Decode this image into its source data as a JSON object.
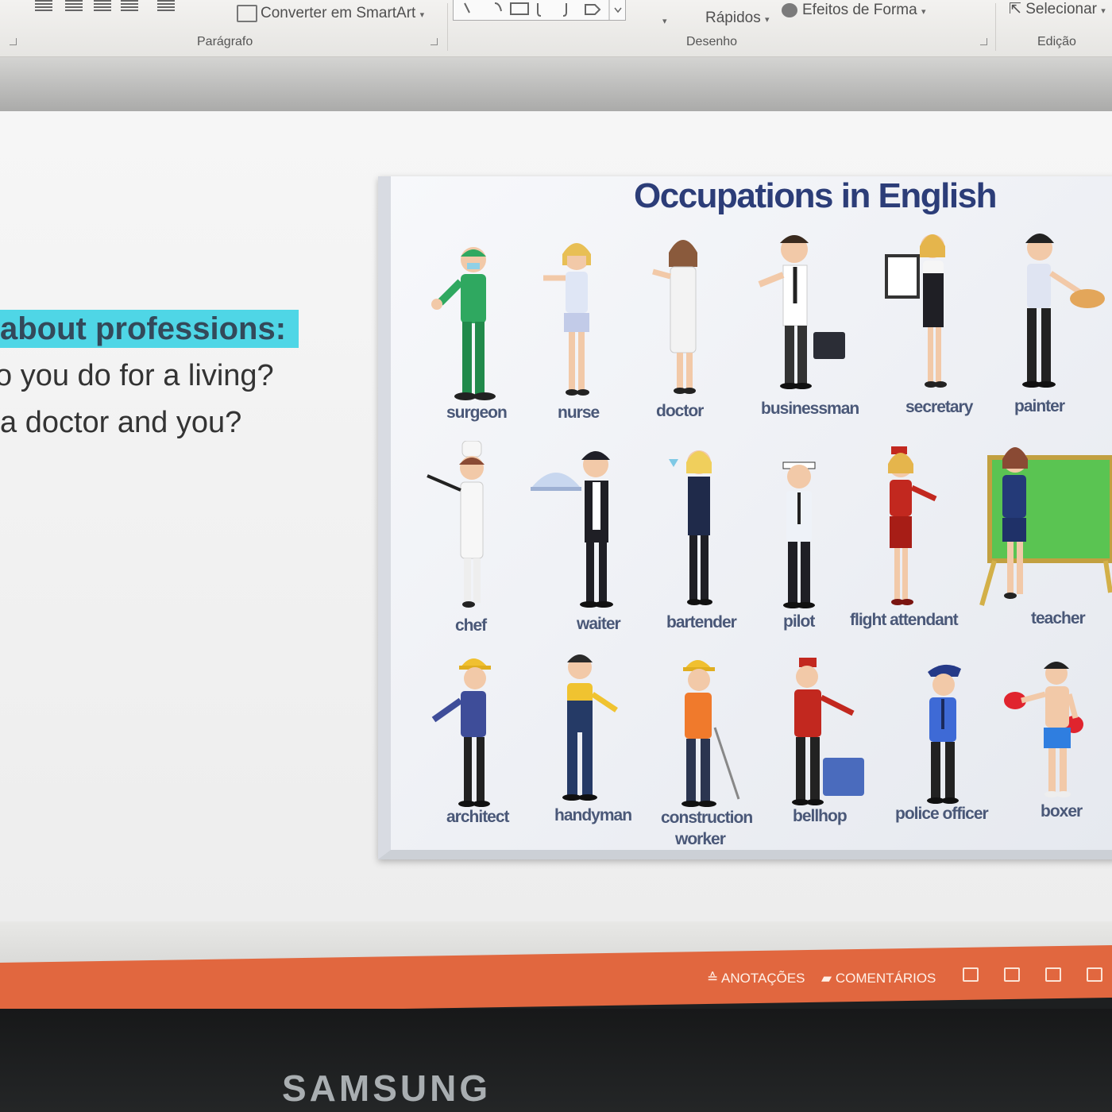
{
  "ribbon": {
    "convert_smartart": "Converter em SmartArt",
    "rapidos": "Rápidos",
    "efeitos_forma": "Efeitos de Forma",
    "selecionar": "Selecionar",
    "group_paragrafo": "Parágrafo",
    "group_desenho": "Desenho",
    "group_edicao": "Edição"
  },
  "slide": {
    "heading": "about professions:",
    "line1": "o you do for a living?",
    "line2": "a doctor and you?"
  },
  "card": {
    "title": "Occupations in English",
    "occupations": [
      "surgeon",
      "nurse",
      "doctor",
      "businessman",
      "secretary",
      "painter",
      "chef",
      "waiter",
      "bartender",
      "pilot",
      "flight attendant",
      "teacher",
      "architect",
      "handyman",
      "construction",
      "worker",
      "bellhop",
      "police officer",
      "boxer"
    ]
  },
  "statusbar": {
    "anotacoes": "ANOTAÇÕES",
    "comentarios": "COMENTÁRIOS"
  },
  "monitor": {
    "brand": "SAMSUNG"
  }
}
